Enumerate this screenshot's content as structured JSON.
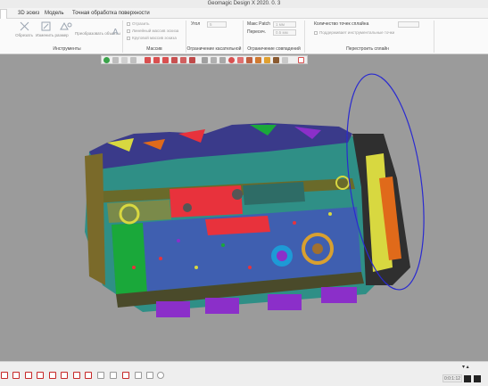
{
  "app": {
    "title": "Geomagic Design X 2020. 0. 3"
  },
  "tabs": [
    {
      "label": "3D эскиз",
      "active": false
    },
    {
      "label": "Модель",
      "active": false
    },
    {
      "label": "Точная обработка поверхности",
      "active": true
    }
  ],
  "ribbon": {
    "tools_group_label": "Инструменты",
    "tools_buttons": [
      {
        "label": "Обрезать",
        "icon": "trim-icon"
      },
      {
        "label": "Изменить размер",
        "icon": "resize-icon"
      },
      {
        "label": "Преобразовать объекты",
        "icon": "transform-icon"
      }
    ],
    "array_group_label": "Массив",
    "array_items": [
      "Отразить",
      "Линейный массив эскиза",
      "Круговой массив эскиза"
    ],
    "tangent_group_label": "Ограничение касательной",
    "angle_label": "Угол",
    "angle_value": "5",
    "coincide_group_label": "Ограничение совпадений",
    "max_patch_label": "Макс Patch",
    "max_patch_value": "1 мм",
    "overlap_label": "Пересеч.",
    "overlap_value": "0.5 мм",
    "retopo_group_label": "Перестроить сплайн",
    "control_points_label": "Количество точек сплайна",
    "control_points_value": "",
    "keep_curvature_label": "Поддерживает инструментальные точки"
  },
  "viewport": {
    "scan_description": "mesh-model",
    "colors": {
      "background": "#9b9b9b",
      "teal": "#2f8f86",
      "red": "#e8323c",
      "blue": "#3f5fb0",
      "green": "#1aa83a",
      "purple": "#8b2fc9",
      "yellow": "#d8d840",
      "selection_ellipse": "#2a2ad0"
    }
  },
  "bottom": {
    "status_value": "0:0:1:12"
  }
}
